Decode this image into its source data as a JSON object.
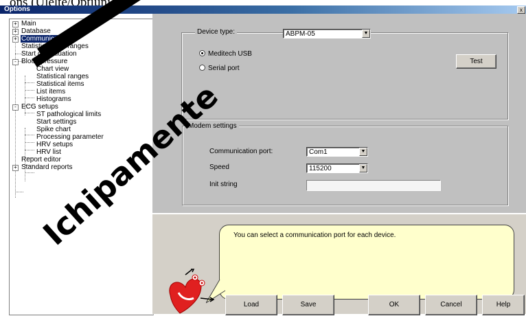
{
  "caption": "ons (Ulelte/Opțiuni).",
  "window": {
    "title": "Options",
    "close_glyph": "x"
  },
  "tree": {
    "items": [
      {
        "label": "Main",
        "expander": "+"
      },
      {
        "label": "Database",
        "expander": "+"
      },
      {
        "label": "Communication",
        "expander": "+",
        "selected": true
      },
      {
        "label": "Statistical time ranges"
      },
      {
        "label": "Start of evaluation"
      },
      {
        "label": "Blood pressure",
        "expander": "-"
      },
      {
        "label": "Chart view"
      },
      {
        "label": "Statistical ranges"
      },
      {
        "label": "Statistical items"
      },
      {
        "label": "List items"
      },
      {
        "label": "Histograms"
      },
      {
        "label": "ECG setups",
        "expander": "-"
      },
      {
        "label": "ST pathological limits"
      },
      {
        "label": "Start settings"
      },
      {
        "label": "Spike chart"
      },
      {
        "label": "Processing parameter"
      },
      {
        "label": "HRV setups"
      },
      {
        "label": "HRV list"
      },
      {
        "label": "Report editor"
      },
      {
        "label": "Standard reports",
        "expander": "+"
      }
    ]
  },
  "device": {
    "type_label": "Device type:",
    "type_value": "ABPM-05",
    "radio_usb": "Meditech USB",
    "radio_serial": "Serial port",
    "test_button": "Test"
  },
  "modem": {
    "title": "Modem settings",
    "port_label": "Communication port:",
    "port_value": "Com1",
    "speed_label": "Speed",
    "speed_value": "115200",
    "init_label": "Init string",
    "init_value": ""
  },
  "help": {
    "text": "You can select a communication port for each device."
  },
  "buttons": {
    "load": "Load",
    "save": "Save",
    "ok": "OK",
    "cancel": "Cancel",
    "help": "Help"
  },
  "watermark": {
    "text": "Ichipamente"
  },
  "colors": {
    "selection": "#0a246a",
    "bubble": "#ffffcc",
    "mascot": "#e02020"
  }
}
